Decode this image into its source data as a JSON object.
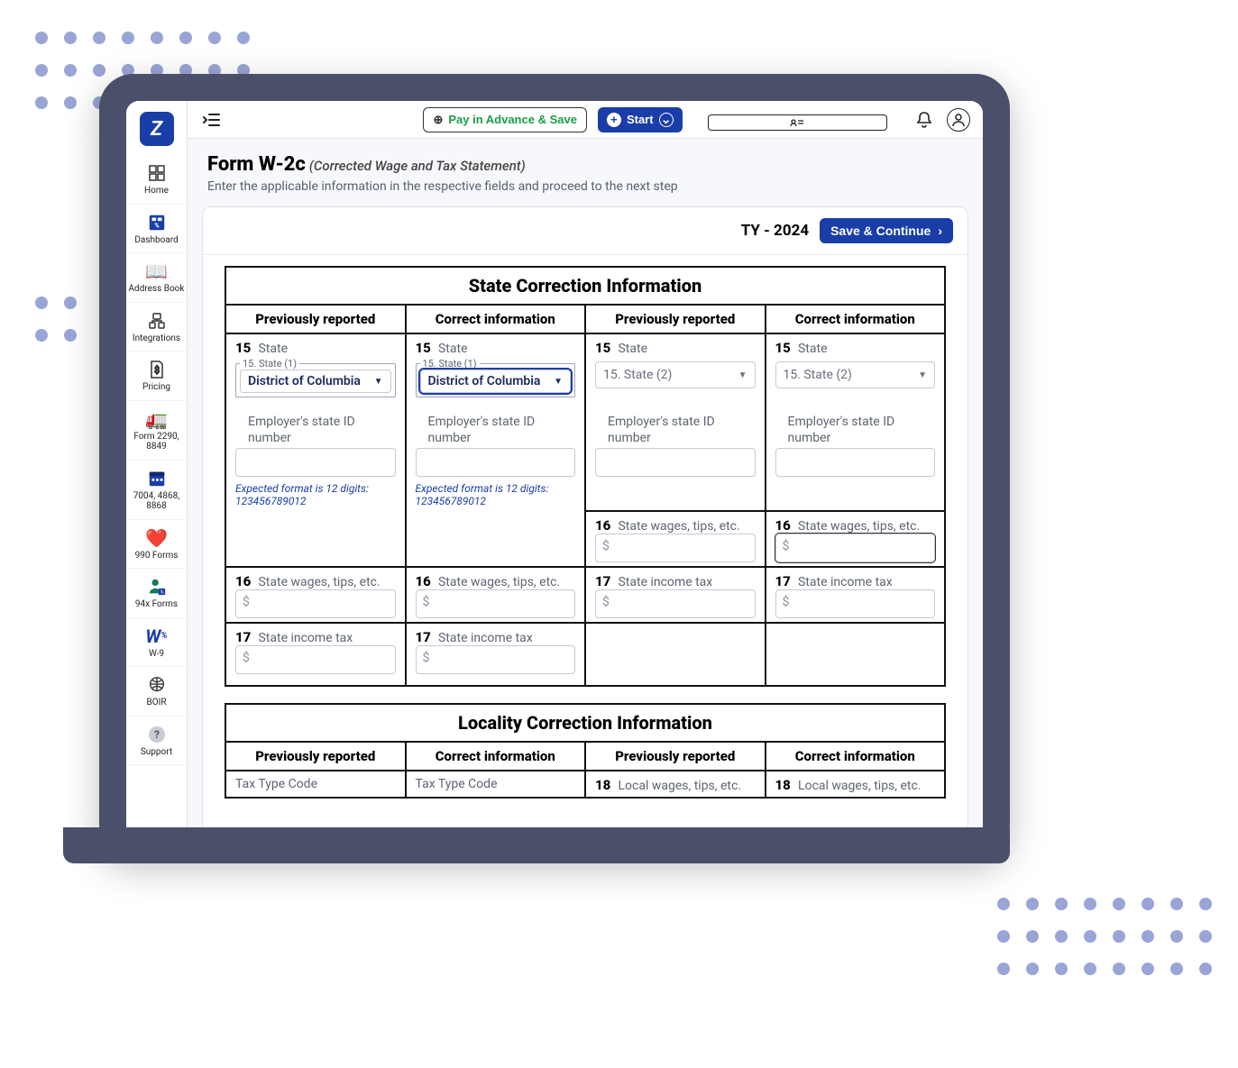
{
  "sidebar": {
    "items": [
      {
        "label": "Home"
      },
      {
        "label": "Dashboard"
      },
      {
        "label": "Address Book"
      },
      {
        "label": "Integrations"
      },
      {
        "label": "Pricing"
      },
      {
        "label": "Form 2290, 8849"
      },
      {
        "label": "7004, 4868, 8868"
      },
      {
        "label": "990 Forms"
      },
      {
        "label": "94x Forms"
      },
      {
        "label": "W-9"
      },
      {
        "label": "BOIR"
      },
      {
        "label": "Support"
      }
    ]
  },
  "topbar": {
    "pay_advance": "Pay in Advance & Save",
    "start": "Start"
  },
  "page": {
    "title": "Form W-2c",
    "subtitle": "(Corrected Wage and Tax Statement)",
    "description": "Enter the applicable information in the respective fields and proceed to the next step"
  },
  "card": {
    "tax_year": "TY - 2024",
    "save_continue": "Save & Continue"
  },
  "state_section": {
    "title": "State Correction Information",
    "headers": [
      "Previously reported",
      "Correct information",
      "Previously reported",
      "Correct information"
    ],
    "box15_label": "State",
    "box15_num": "15",
    "state1_legend": "15. State (1)",
    "state1_value": "District of Columbia",
    "state2_placeholder": "15. State (2)",
    "employer_id_label": "Employer's state ID number",
    "expected_format": "Expected format is 12 digits: 123456789012",
    "box16_num": "16",
    "box16_label": "State wages, tips, etc.",
    "box17_num": "17",
    "box17_label": "State income tax"
  },
  "locality_section": {
    "title": "Locality Correction Information",
    "headers": [
      "Previously reported",
      "Correct information",
      "Previously reported",
      "Correct information"
    ],
    "tax_type_label": "Tax Type Code",
    "box18_num": "18",
    "box18_label": "Local wages, tips, etc."
  }
}
